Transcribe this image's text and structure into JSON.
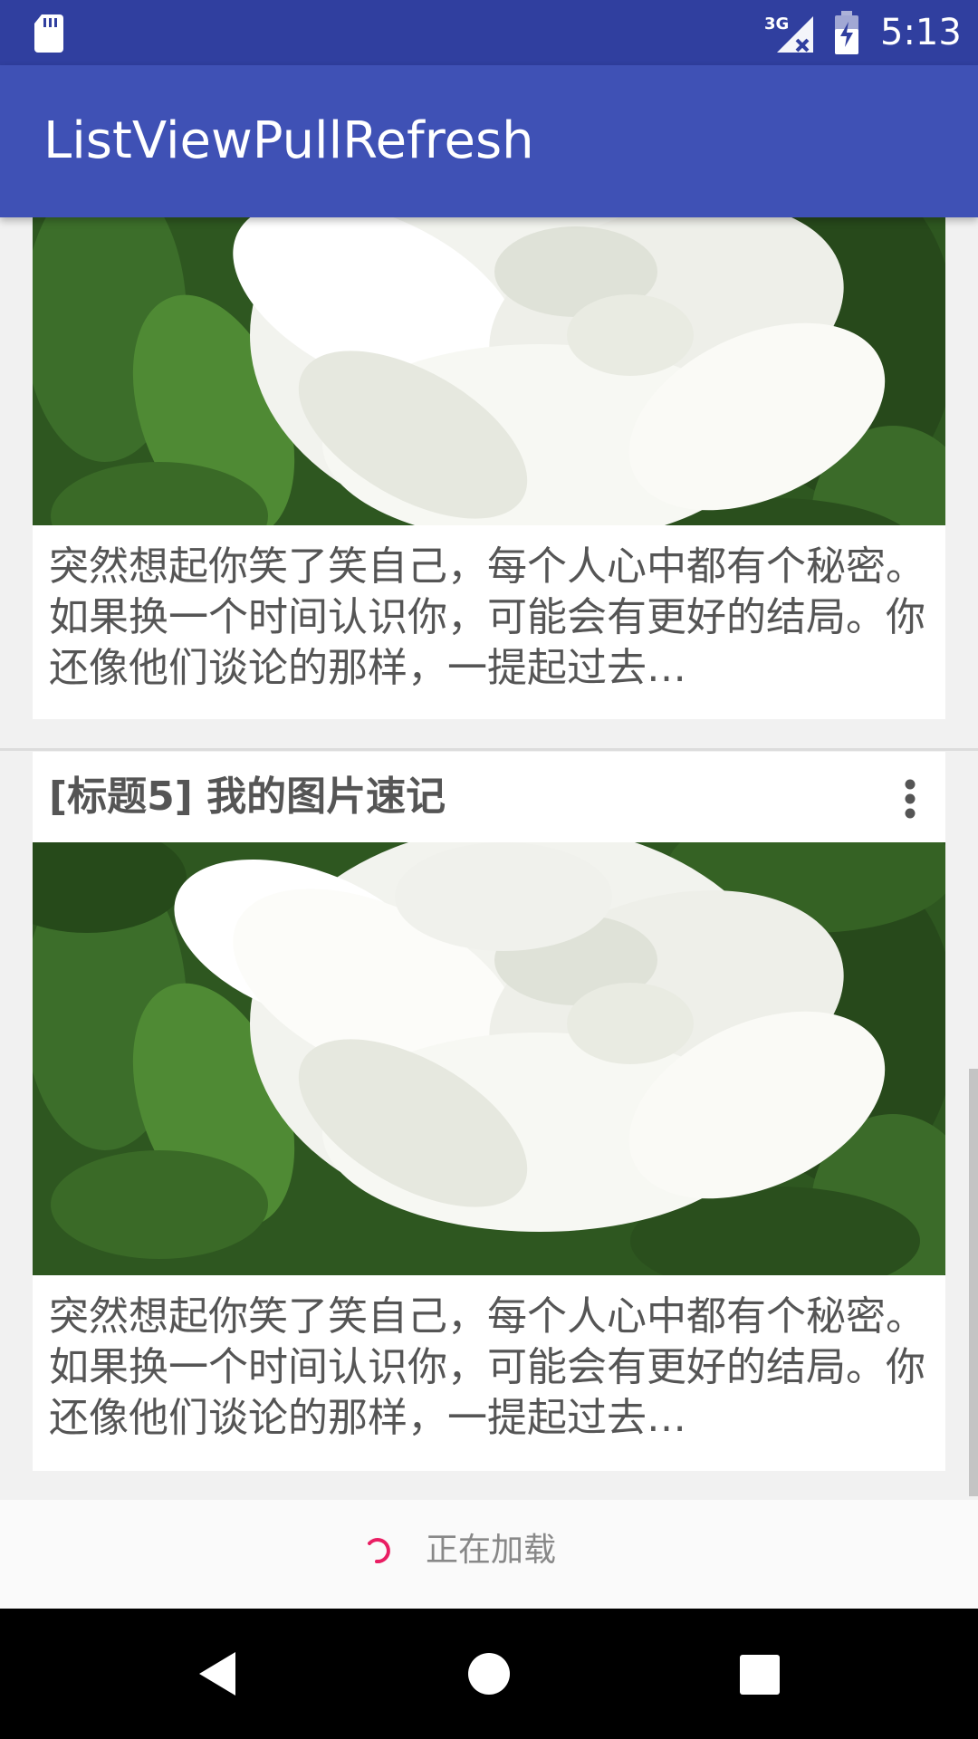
{
  "status_bar": {
    "time": "5:13",
    "network": "3G",
    "icons": [
      "sd-card-icon",
      "signal-no-data-icon",
      "battery-charging-icon"
    ]
  },
  "app_bar": {
    "title": "ListViewPullRefresh"
  },
  "cards": [
    {
      "title": "",
      "description": "突然想起你笑了笑自己，每个人心中都有个秘密。如果换一个时间认识你，可能会有更好的结局。你还像他们谈论的那样，一提起过去…",
      "image_icon": "gardenia-flower-photo"
    },
    {
      "title": "[标题5] 我的图片速记",
      "description": "突然想起你笑了笑自己，每个人心中都有个秘密。如果换一个时间认识你，可能会有更好的结局。你还像他们谈论的那样，一提起过去…",
      "image_icon": "gardenia-flower-photo"
    }
  ],
  "footer": {
    "loading_text": "正在加载"
  },
  "nav": {
    "icons": [
      "back-icon",
      "home-icon",
      "recents-icon"
    ]
  },
  "colors": {
    "status_bar": "#303f9f",
    "app_bar": "#3f51b5",
    "spinner": "#e91e63",
    "background": "#f1f1f1"
  }
}
